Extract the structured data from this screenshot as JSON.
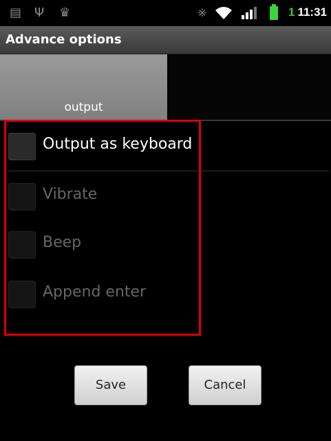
{
  "statusbar": {
    "time": "11:31",
    "notification_count": "1",
    "icons": [
      "screenshot-icon",
      "usb-icon",
      "android-debug-icon",
      "bluetooth-icon",
      "wifi-icon",
      "signal-icon",
      "battery-icon"
    ],
    "battery_color": "#3ed33e",
    "notification_color": "#2ad32a"
  },
  "titlebar": {
    "title": "Advance options"
  },
  "tabs": [
    {
      "label": "output",
      "selected": true
    },
    {
      "label": "",
      "selected": false
    }
  ],
  "options": [
    {
      "label": "Output as keyboard",
      "checked": false,
      "enabled": true
    },
    {
      "label": "Vibrate",
      "checked": false,
      "enabled": false
    },
    {
      "label": "Beep",
      "checked": false,
      "enabled": false
    },
    {
      "label": "Append enter",
      "checked": false,
      "enabled": false
    }
  ],
  "buttons": {
    "save": "Save",
    "cancel": "Cancel"
  },
  "highlight_color": "#e00000"
}
